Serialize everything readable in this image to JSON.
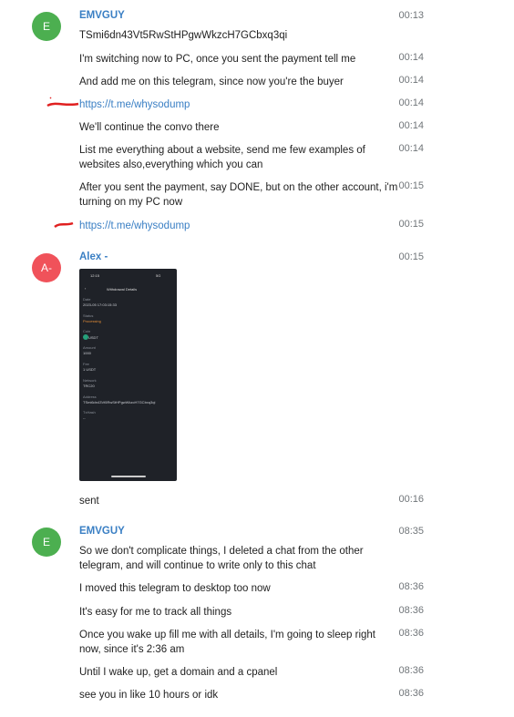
{
  "colors": {
    "avatar_e": "#4caf50",
    "avatar_a": "#f0525a",
    "link": "#3a7fc4",
    "sender": "#3a7fc4"
  },
  "groups": [
    {
      "avatar": "E",
      "sender": "EMVGUY"
    },
    {
      "avatar": "A-",
      "sender": "Alex -"
    },
    {
      "avatar": "E",
      "sender": "EMVGUY"
    }
  ],
  "messages": [
    {
      "text": "TSmi6dn43Vt5RwStHPgwWkzcH7GCbxq3qi",
      "time": "00:13"
    },
    {
      "text": "I'm switching now to PC, once you sent the payment tell me",
      "time": "00:14"
    },
    {
      "text": "And add me on this telegram, since now you're the buyer",
      "time": "00:14"
    },
    {
      "text": "https://t.me/whysodump",
      "time": "00:14"
    },
    {
      "text": "We'll continue the convo there",
      "time": "00:14"
    },
    {
      "text": "List me everything about a website, send me few examples of websites also,everything which you can",
      "time": "00:14"
    },
    {
      "text": "After you sent the payment, say DONE, but on the other account, i'm turning on my PC now",
      "time": "00:15"
    },
    {
      "text": "https://t.me/whysodump",
      "time": "00:15"
    },
    {
      "text": "",
      "time": "00:15"
    },
    {
      "text": "sent",
      "time": "00:16"
    },
    {
      "text": "So we don't complicate things, I deleted a chat from the other telegram, and will continue to write only to this chat",
      "time": "08:35"
    },
    {
      "text": "I moved this telegram to desktop too now",
      "time": "08:36"
    },
    {
      "text": "It's easy for me to track all things",
      "time": "08:36"
    },
    {
      "text": "Once you wake up fill me with all details, I'm going to sleep right now, since it's 2:36 am",
      "time": "08:36"
    },
    {
      "text": "Until I wake up, get a domain and a cpanel",
      "time": "08:36"
    },
    {
      "text": "see you in like 10 hours or idk",
      "time": "08:36"
    }
  ],
  "screenshot": {
    "status_time": "12:15",
    "status_icons": "5G",
    "title": "Withdrawal Details",
    "rows": [
      {
        "label": "Date",
        "value": "2023-05 17:03:15:33"
      },
      {
        "label": "Status",
        "value": "Processing"
      },
      {
        "label": "Coin",
        "value": "USDT"
      },
      {
        "label": "Amount",
        "value": "1000"
      },
      {
        "label": "Fee",
        "value": "1 USDT"
      },
      {
        "label": "Network",
        "value": "TRC20"
      },
      {
        "label": "Address",
        "value": "TSmi6dn43Vt5RwStHPgwWkzcH7GCbxq3qi"
      },
      {
        "label": "TxHash",
        "value": "--"
      }
    ]
  }
}
